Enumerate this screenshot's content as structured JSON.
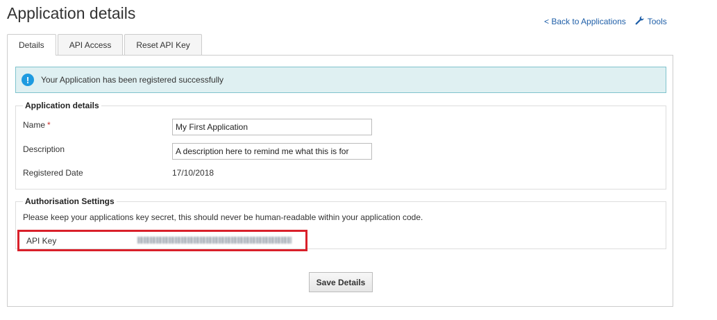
{
  "header": {
    "title": "Application details",
    "back_link": "< Back to Applications",
    "tools_label": "Tools",
    "tools_icon": "wrench-icon"
  },
  "tabs": [
    {
      "label": "Details",
      "active": true
    },
    {
      "label": "API Access",
      "active": false
    },
    {
      "label": "Reset API Key",
      "active": false
    }
  ],
  "alert": {
    "icon": "info-icon",
    "icon_glyph": "!",
    "message": "Your Application has been registered successfully"
  },
  "application_details": {
    "legend": "Application details",
    "name_label": "Name",
    "required_mark": "*",
    "name_value": "My First Application",
    "description_label": "Description",
    "description_value": "A description here to remind me what this is for",
    "registered_label": "Registered Date",
    "registered_value": "17/10/2018"
  },
  "authorisation": {
    "legend": "Authorisation Settings",
    "info_text": "Please keep your applications key secret, this should never be human-readable within your application code.",
    "api_key_label": "API Key"
  },
  "actions": {
    "save_label": "Save Details"
  },
  "colors": {
    "link": "#1f5fa8",
    "alert_bg": "#dff0f2",
    "alert_border": "#7fc3cd",
    "highlight_border": "#d9202a"
  }
}
